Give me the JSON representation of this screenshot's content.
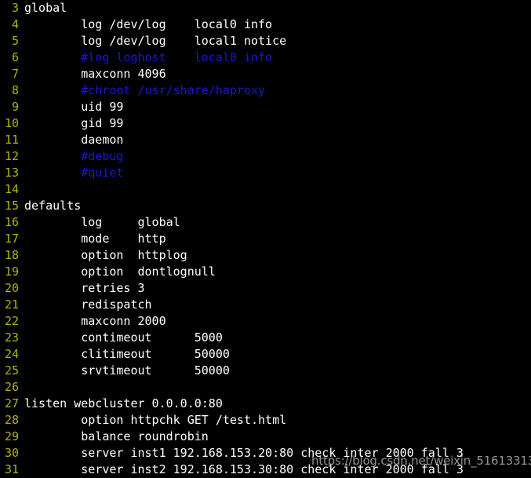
{
  "editor": {
    "kind": "terminal-text-editor",
    "background_color": "#000000",
    "line_number_color": "#b3b300",
    "text_color": "#ffffff",
    "comment_color": "#1818cf",
    "first_visible_line": 3,
    "last_visible_line": 31,
    "lines": [
      {
        "num": "3",
        "text": "global",
        "comment": false
      },
      {
        "num": "4",
        "text": "        log /dev/log    local0 info",
        "comment": false
      },
      {
        "num": "5",
        "text": "        log /dev/log    local1 notice",
        "comment": false
      },
      {
        "num": "6",
        "text": "        #log loghost    local0 info",
        "comment": true
      },
      {
        "num": "7",
        "text": "        maxconn 4096",
        "comment": false
      },
      {
        "num": "8",
        "text": "        #chroot /usr/share/haproxy",
        "comment": true
      },
      {
        "num": "9",
        "text": "        uid 99",
        "comment": false
      },
      {
        "num": "10",
        "text": "        gid 99",
        "comment": false
      },
      {
        "num": "11",
        "text": "        daemon",
        "comment": false
      },
      {
        "num": "12",
        "text": "        #debug",
        "comment": true
      },
      {
        "num": "13",
        "text": "        #quiet",
        "comment": true
      },
      {
        "num": "14",
        "text": "",
        "comment": false
      },
      {
        "num": "15",
        "text": "defaults",
        "comment": false
      },
      {
        "num": "16",
        "text": "        log     global",
        "comment": false
      },
      {
        "num": "17",
        "text": "        mode    http",
        "comment": false
      },
      {
        "num": "18",
        "text": "        option  httplog",
        "comment": false
      },
      {
        "num": "19",
        "text": "        option  dontlognull",
        "comment": false
      },
      {
        "num": "20",
        "text": "        retries 3",
        "comment": false
      },
      {
        "num": "21",
        "text": "        redispatch",
        "comment": false
      },
      {
        "num": "22",
        "text": "        maxconn 2000",
        "comment": false
      },
      {
        "num": "23",
        "text": "        contimeout      5000",
        "comment": false
      },
      {
        "num": "24",
        "text": "        clitimeout      50000",
        "comment": false
      },
      {
        "num": "25",
        "text": "        srvtimeout      50000",
        "comment": false
      },
      {
        "num": "26",
        "text": "",
        "comment": false
      },
      {
        "num": "27",
        "text": "listen webcluster 0.0.0.0:80",
        "comment": false
      },
      {
        "num": "28",
        "text": "        option httpchk GET /test.html",
        "comment": false
      },
      {
        "num": "29",
        "text": "        balance roundrobin",
        "comment": false
      },
      {
        "num": "30",
        "text": "        server inst1 192.168.153.20:80 check inter 2000 fall 3",
        "comment": false
      },
      {
        "num": "31",
        "text": "        server inst2 192.168.153.30:80 check inter 2000 fall 3",
        "comment": false
      }
    ]
  },
  "watermark": {
    "text": "https://blog.csdn.net/weixin_51613313"
  }
}
